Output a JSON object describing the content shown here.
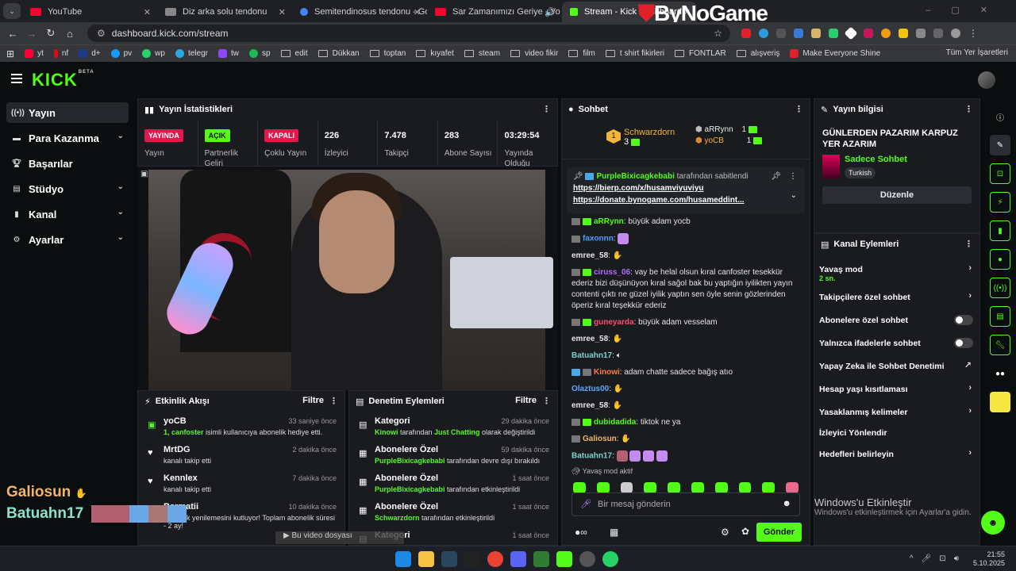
{
  "browser": {
    "tabs": [
      {
        "title": "YouTube",
        "color": "#ff0033"
      },
      {
        "title": "Diz arka solu tendonu",
        "color": "#888888"
      },
      {
        "title": "Semitendinosus tendonu - Goo",
        "color": "#4285f4"
      },
      {
        "title": "Sar Zamanımızı Geriye - Yo",
        "color": "#ff0033"
      },
      {
        "title": "Stream - Kick Dashboard",
        "color": "#53fc18"
      }
    ],
    "overlay_logo": "ByNoGame",
    "url": "dashboard.kick.com/stream",
    "bookmarks": [
      "yt",
      "nf",
      "d+",
      "pv",
      "wp",
      "telegr",
      "tw",
      "sp",
      "edit",
      "Dükkan",
      "toptan",
      "kıyafet",
      "steam",
      "video fikir",
      "film",
      "t shirt fikirleri",
      "FONTLAR",
      "alışveriş",
      "Make Everyone Shine"
    ],
    "bookmarks_right": "Tüm Yer İşaretleri"
  },
  "kick": {
    "logo": "KICK",
    "logo_sup": "BETA"
  },
  "sidebar": {
    "items": [
      {
        "label": "Yayın",
        "icon": "broadcast-icon"
      },
      {
        "label": "Para Kazanma",
        "icon": "money-icon"
      },
      {
        "label": "Başarılar",
        "icon": "trophy-icon"
      },
      {
        "label": "Stüdyo",
        "icon": "studio-icon"
      },
      {
        "label": "Kanal",
        "icon": "channel-icon"
      },
      {
        "label": "Ayarlar",
        "icon": "gear-icon"
      }
    ]
  },
  "stats": {
    "title": "Yayın İstatistikleri",
    "items": [
      {
        "value": "YAYINDA",
        "label": "Yayın"
      },
      {
        "value": "AÇIK",
        "label": "Partnerlik Geliri"
      },
      {
        "value": "KAPALI",
        "label": "Çoklu Yayın"
      },
      {
        "value": "226",
        "label": "İzleyici"
      },
      {
        "value": "7.478",
        "label": "Takipçi"
      },
      {
        "value": "283",
        "label": "Abone Sayısı"
      },
      {
        "value": "03:29:54",
        "label": "Yayında Olduğu"
      }
    ]
  },
  "video_overlay": {
    "line1_name": "Galiosun",
    "line2_name": "Batuahn17",
    "yt_text": "Bu video dosyası"
  },
  "activity": {
    "title": "Etkinlik Akışı",
    "filter": "Filtre",
    "events": [
      {
        "user": "yoCB",
        "detail_a": "1, canfoster",
        "detail_b": " isimli kullanıcıya abonelik hediye etti.",
        "time": "33 saniye önce"
      },
      {
        "user": "MrtDG",
        "detail_a": "",
        "detail_b": "kanalı takip etti",
        "time": "2 dakika önce"
      },
      {
        "user": "Kennlex",
        "detail_a": "",
        "detail_b": "kanalı takip etti",
        "time": "7 dakika önce"
      },
      {
        "user": "Barmatii",
        "detail_a": "",
        "detail_b": "abonelik yenilemesini kutluyor! Toplam abonelik süresi - 2 ay!",
        "time": "10 dakika önce"
      }
    ]
  },
  "moderation": {
    "title": "Denetim Eylemleri",
    "filter": "Filtre",
    "events": [
      {
        "title": "Kategori",
        "who": "Kinowi",
        "mid": " tarafından ",
        "what": "Just Chatting",
        "end": " olarak değiştirildi",
        "time": "29 dakika önce"
      },
      {
        "title": "Abonelere Özel",
        "who": "PurpleBixicagkebabi",
        "mid": " tarafından devre dışı bırakıldı",
        "what": "",
        "end": "",
        "time": "59 dakika önce"
      },
      {
        "title": "Abonelere Özel",
        "who": "PurpleBixicagkebabi",
        "mid": " tarafından etkinleştirildi",
        "what": "",
        "end": "",
        "time": "1 saat önce"
      },
      {
        "title": "Abonelere Özel",
        "who": "Schwarzdorn",
        "mid": " tarafından etkinleştirildi",
        "what": "",
        "end": "",
        "time": "1 saat önce"
      },
      {
        "title": "Kategori",
        "who": "",
        "mid": "",
        "what": "",
        "end": "",
        "time": "1 saat önce"
      }
    ]
  },
  "chat": {
    "title": "Sohbet",
    "leaders": {
      "first": {
        "rank": "1",
        "name": "Schwarzdorn",
        "count": "3"
      },
      "second": {
        "name": "aRRynn",
        "count": "1"
      },
      "third": {
        "name": "yoCB",
        "count": "1"
      }
    },
    "pinned": {
      "by": "PurpleBixicagkebabi",
      "suffix": "tarafından sabitlendi",
      "link1": "https://bierp.com/x/husamviyuviyu",
      "link2": "https://donate.bynogame.com/husameddint..."
    },
    "messages": [
      {
        "user": "aRRynn",
        "color": "#53fc18",
        "text": "büyük adam yocb"
      },
      {
        "user": "faxonnn",
        "color": "#4a9eff",
        "text": ""
      },
      {
        "user": "emree_58",
        "color": "#e5e5e5",
        "text": ""
      },
      {
        "user": "ciruss_06",
        "color": "#b36bff",
        "text": "vay be helal olsun kıral canfoster tesekkür ederiz bizi düşünüyon kıral sağol bak bu yaptığın iyilikten yayın contenti çıktı ne güzel iyilik yaptın sen öyle senin gözlerinden öperiz kıral teşekkür ederiz"
      },
      {
        "user": "guneyarda",
        "color": "#ff4d6d",
        "text": "büyük adam vesselam"
      },
      {
        "user": "emree_58",
        "color": "#e5e5e5",
        "text": ""
      },
      {
        "user": "Batuahn17",
        "color": "#7fd0c8",
        "text": ""
      },
      {
        "user": "Kinowi",
        "color": "#ff7a45",
        "text": "adam chatte sadece bağış atıo"
      },
      {
        "user": "Olaztus00",
        "color": "#5aa7ff",
        "text": ""
      },
      {
        "user": "emree_58",
        "color": "#e5e5e5",
        "text": ""
      },
      {
        "user": "dubidadida",
        "color": "#53fc18",
        "text": "tiktok ne ya"
      },
      {
        "user": "Galiosun",
        "color": "#f0b56b",
        "text": ""
      },
      {
        "user": "Batuahn17",
        "color": "#7fd0c8",
        "text": ""
      }
    ],
    "slowmode": "Yavaş mod aktif",
    "input_placeholder": "Bir mesaj gönderin",
    "send": "Gönder"
  },
  "info": {
    "title": "Yayın bilgisi",
    "stream_title": "GÜNLERDEN PAZARIM KARPUZ YER AZARIM",
    "category": "Sadece Sohbet",
    "language": "Turkish",
    "edit": "Düzenle"
  },
  "channel_actions": {
    "title": "Kanal Eylemleri",
    "items": [
      {
        "label": "Yavaş mod",
        "sub": "2 sn."
      },
      {
        "label": "Takipçilere özel sohbet",
        "sub": ""
      },
      {
        "label": "Abonelere özel sohbet",
        "sub": ""
      },
      {
        "label": "Yalnızca ifadelerle sohbet",
        "sub": ""
      },
      {
        "label": "Yapay Zeka ile Sohbet Denetimi",
        "sub": ""
      },
      {
        "label": "Hesap yaşı kısıtlaması",
        "sub": ""
      },
      {
        "label": "Yasaklanmış kelimeler",
        "sub": ""
      },
      {
        "label": "İzleyici Yönlendir",
        "sub": ""
      },
      {
        "label": "Hedefleri belirleyin",
        "sub": ""
      }
    ]
  },
  "windows": {
    "activate_title": "Windows'u Etkinleştir",
    "activate_sub": "Windows'u etkinleştirmek için Ayarlar'a gidin.",
    "time": "21:55",
    "date": "5.10.2025"
  }
}
